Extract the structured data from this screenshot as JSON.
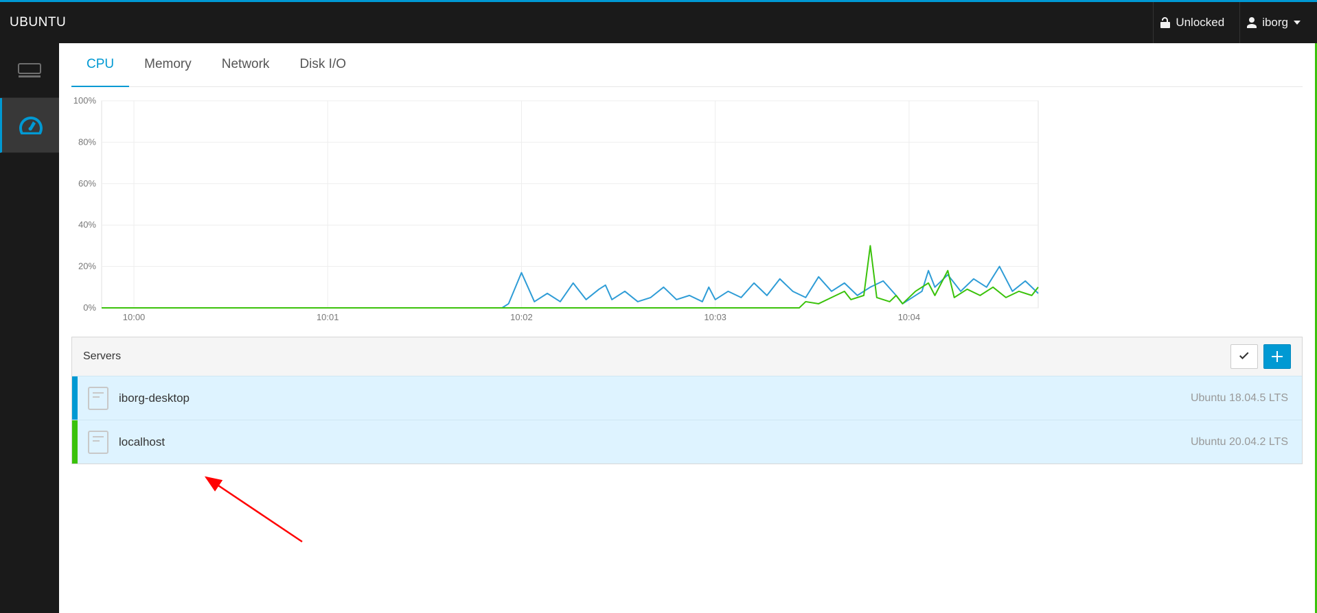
{
  "header": {
    "brand": "UBUNTU",
    "lock_label": "Unlocked",
    "user_label": "iborg"
  },
  "sidebar": {
    "items": [
      {
        "name": "host-icon",
        "active": false
      },
      {
        "name": "dashboard-icon",
        "active": true
      }
    ]
  },
  "tabs": [
    {
      "key": "cpu",
      "label": "CPU",
      "active": true
    },
    {
      "key": "memory",
      "label": "Memory",
      "active": false
    },
    {
      "key": "network",
      "label": "Network",
      "active": false
    },
    {
      "key": "diskio",
      "label": "Disk I/O",
      "active": false
    }
  ],
  "servers_panel": {
    "title": "Servers",
    "rows": [
      {
        "name": "iborg-desktop",
        "os": "Ubuntu 18.04.5 LTS",
        "color": "#0099d3"
      },
      {
        "name": "localhost",
        "os": "Ubuntu 20.04.2 LTS",
        "color": "#3ac20a"
      }
    ]
  },
  "chart_data": {
    "type": "line",
    "ylabel": "",
    "xlabel": "",
    "ylim": [
      0,
      100
    ],
    "y_unit": "%",
    "y_ticks": [
      0,
      20,
      40,
      60,
      80,
      100
    ],
    "x_ticks": [
      "10:00",
      "10:01",
      "10:02",
      "10:03",
      "10:04"
    ],
    "x_range_seconds": [
      -10,
      280
    ],
    "series": [
      {
        "name": "iborg-desktop",
        "color": "#2e9cd6",
        "points": [
          [
            -10,
            0
          ],
          [
            114,
            0
          ],
          [
            116,
            2
          ],
          [
            120,
            17
          ],
          [
            124,
            3
          ],
          [
            128,
            7
          ],
          [
            132,
            3
          ],
          [
            136,
            12
          ],
          [
            140,
            4
          ],
          [
            144,
            9
          ],
          [
            146,
            11
          ],
          [
            148,
            4
          ],
          [
            152,
            8
          ],
          [
            156,
            3
          ],
          [
            160,
            5
          ],
          [
            164,
            10
          ],
          [
            168,
            4
          ],
          [
            172,
            6
          ],
          [
            176,
            3
          ],
          [
            178,
            10
          ],
          [
            180,
            4
          ],
          [
            184,
            8
          ],
          [
            188,
            5
          ],
          [
            192,
            12
          ],
          [
            196,
            6
          ],
          [
            200,
            14
          ],
          [
            204,
            8
          ],
          [
            208,
            5
          ],
          [
            212,
            15
          ],
          [
            216,
            8
          ],
          [
            220,
            12
          ],
          [
            224,
            6
          ],
          [
            228,
            10
          ],
          [
            232,
            13
          ],
          [
            236,
            6
          ],
          [
            238,
            2
          ],
          [
            240,
            4
          ],
          [
            244,
            8
          ],
          [
            246,
            18
          ],
          [
            248,
            10
          ],
          [
            252,
            16
          ],
          [
            256,
            8
          ],
          [
            260,
            14
          ],
          [
            264,
            10
          ],
          [
            268,
            20
          ],
          [
            272,
            8
          ],
          [
            276,
            13
          ],
          [
            280,
            7
          ]
        ]
      },
      {
        "name": "localhost",
        "color": "#3ac20a",
        "points": [
          [
            -10,
            0
          ],
          [
            206,
            0
          ],
          [
            208,
            3
          ],
          [
            212,
            2
          ],
          [
            216,
            5
          ],
          [
            220,
            8
          ],
          [
            222,
            4
          ],
          [
            226,
            6
          ],
          [
            228,
            30
          ],
          [
            230,
            5
          ],
          [
            234,
            3
          ],
          [
            236,
            6
          ],
          [
            238,
            2
          ],
          [
            242,
            8
          ],
          [
            246,
            12
          ],
          [
            248,
            6
          ],
          [
            252,
            18
          ],
          [
            254,
            5
          ],
          [
            258,
            9
          ],
          [
            262,
            6
          ],
          [
            266,
            10
          ],
          [
            270,
            5
          ],
          [
            274,
            8
          ],
          [
            278,
            6
          ],
          [
            280,
            10
          ]
        ]
      }
    ]
  },
  "annotation": {
    "type": "arrow",
    "color": "#ff0000"
  }
}
